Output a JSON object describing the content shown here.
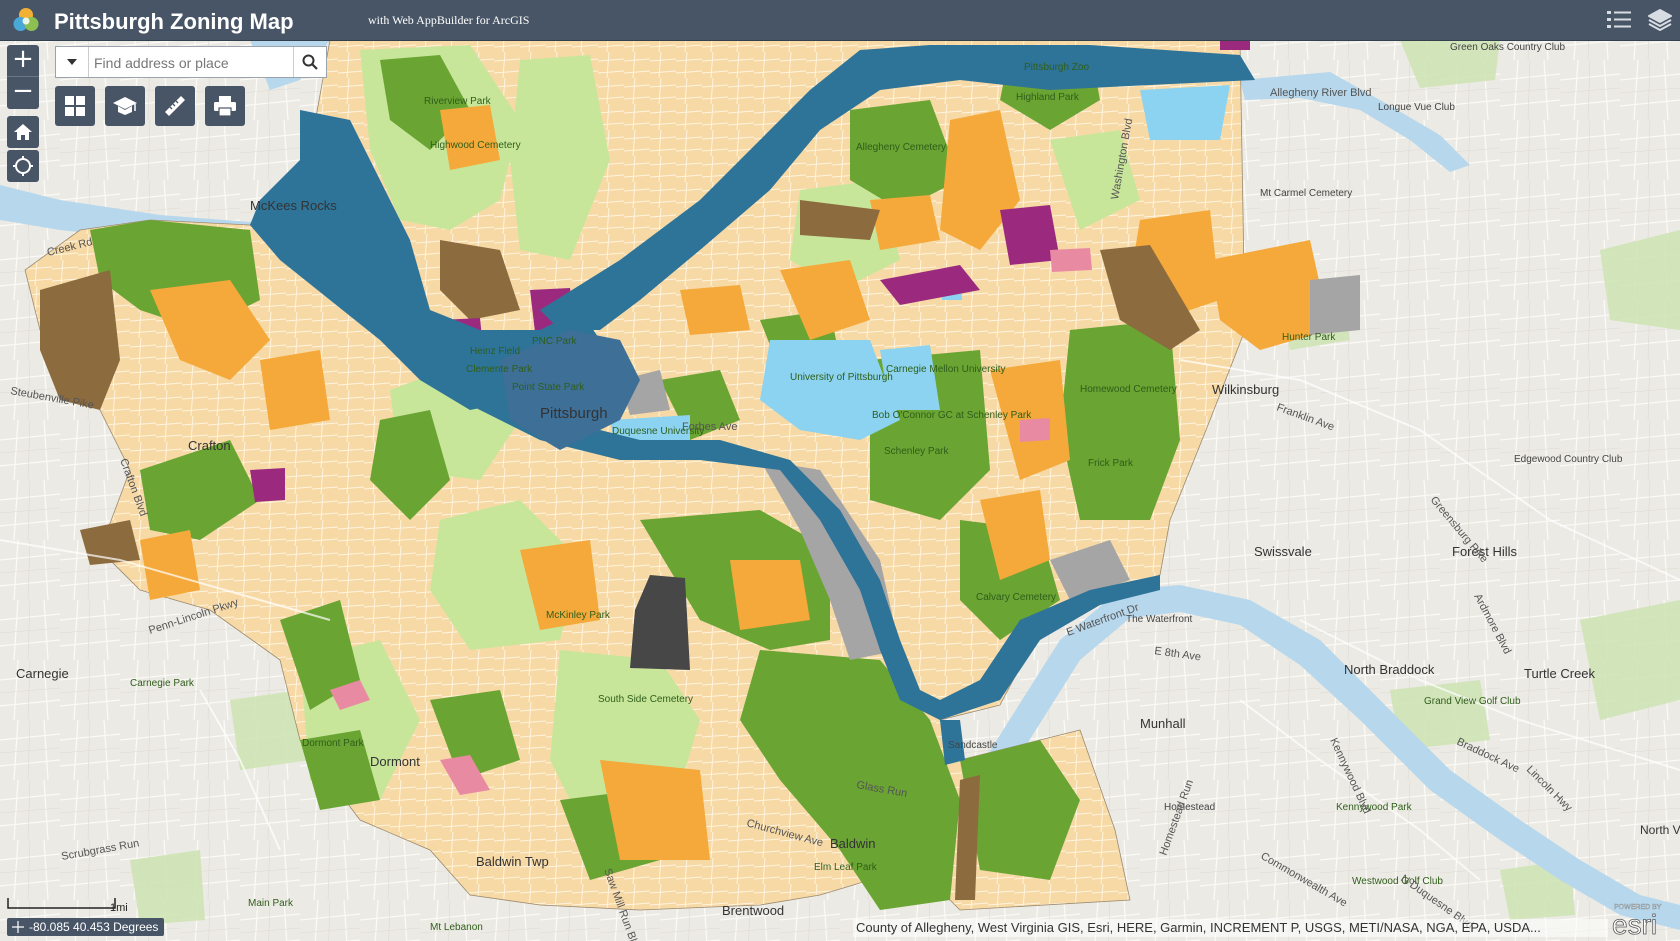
{
  "header": {
    "title": "Pittsburgh Zoning Map",
    "subtitle": "with Web AppBuilder for ArcGIS"
  },
  "search": {
    "placeholder": "Find address or place"
  },
  "scale": {
    "label": "1mi"
  },
  "coordinates": {
    "text": "-80.085 40.453 Degrees"
  },
  "attribution": "County of Allegheny, West Virginia GIS, Esri, HERE, Garmin, INCREMENT P, USGS, METI/NASA, NGA, EPA, USDA...",
  "esri_logo": {
    "powered_by": "POWERED BY",
    "brand": "esri"
  },
  "colors": {
    "header": "#485566",
    "basemap": "#eceae4",
    "river": "#b7d7ec",
    "residential": "#f7d9a6",
    "mixed_residential": "#fbe9b7",
    "neighborhood_commercial": "#f4a93a",
    "open_space": "#6aa433",
    "light_green": "#c8e69a",
    "riverfront_district": "#2e7398",
    "downtown": "#3d6f97",
    "educational": "#8bd3f0",
    "industrial": "#8c6b3f",
    "urban_industrial": "#a5a5a5",
    "highway_commercial": "#9b2a7f",
    "parking_or_pink": "#e98aa3"
  },
  "places": [
    "Pittsburgh",
    "McKees Rocks",
    "Crafton",
    "Carnegie",
    "Dormont",
    "Baldwin Twp",
    "Baldwin",
    "Brentwood",
    "Munhall",
    "Swissvale",
    "Forest Hills",
    "North Braddock",
    "Turtle Creek",
    "Wilkinsburg",
    "Edgewood Country Club",
    "Green Oaks Country Club",
    "Longue Vue Club",
    "Mt Carmel Cemetery",
    "Homestead",
    "Sandcastle",
    "The Waterfront",
    "North Versailles",
    "Riverview Park",
    "Highwood Cemetery",
    "Allegheny Cemetery",
    "Highland Park",
    "Pittsburgh Zoo",
    "Homewood Cemetery",
    "Frick Park",
    "Hunter Park",
    "University of Pittsburgh",
    "Carnegie Mellon University",
    "Duquesne University",
    "Bob O'Connor GC at Schenley Park",
    "Schenley Park",
    "Heinz Field",
    "PNC Park",
    "Clemente Park",
    "Point State Park",
    "McKinley Park",
    "South Side Cemetery",
    "Calvary Cemetery",
    "Dormont Park",
    "Carnegie Park",
    "Main Park",
    "Grand View Golf Club",
    "Kennywood Park",
    "Westwood Golf Club",
    "Elm Leaf Park",
    "Mt Lebanon"
  ],
  "roads": [
    "Allegheny River Blvd",
    "Washington Blvd",
    "Penn-Lincoln Pkwy",
    "Crafton Blvd",
    "Steubenville Pike",
    "Creek Rd",
    "Forbes Ave",
    "Kennywood Blvd",
    "Ardmore Blvd",
    "Lincoln Hwy",
    "E 8th Ave",
    "E Waterfront Dr",
    "Saw Mill Run Blvd",
    "Churchview Ave",
    "Greensburg Pike",
    "Franklin Ave",
    "Braddock Ave",
    "Scrubgrass Run",
    "Glass Run",
    "N Duquesne Blvd",
    "Commonwealth Ave",
    "Homestead Run"
  ]
}
